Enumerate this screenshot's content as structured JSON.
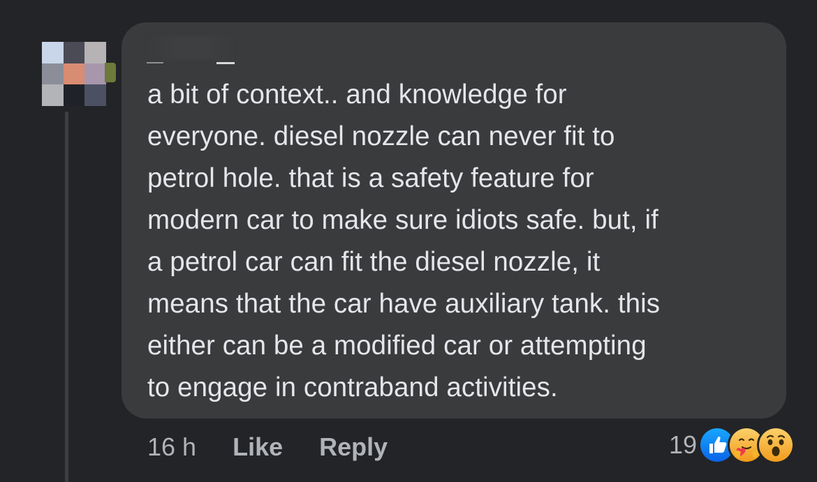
{
  "comment": {
    "text": "a bit of context.. and knowledge for\neveryone. diesel nozzle can never fit to\npetrol hole. that is a safety feature for\nmodern car to make sure idiots safe. but, if\na petrol car can fit the diesel nozzle, it\nmeans that the car have auxiliary tank. this\neither can be a modified car or attempting\nto engage in contraband activities."
  },
  "actions": {
    "timestamp": "16 h",
    "like_label": "Like",
    "reply_label": "Reply"
  },
  "reactions": {
    "count": "19",
    "icons": [
      "like-reaction-icon",
      "care-reaction-icon",
      "wow-reaction-icon"
    ],
    "colors": {
      "like": "#1877f2",
      "care": "#f7b125",
      "wow": "#f7b125"
    }
  },
  "avatar": {
    "pixel_colors": [
      "#c9d6ea",
      "#4a4b55",
      "#b7b2b4",
      "#8b8e99",
      "#d88c72",
      "#a896ad",
      "#b3b4b8",
      "#20222a",
      "#4b5163"
    ]
  },
  "theme": {
    "background": "#232427",
    "bubble": "#3a3b3c",
    "text": "#e4e6eb",
    "secondary_text": "#b0b3b8"
  }
}
